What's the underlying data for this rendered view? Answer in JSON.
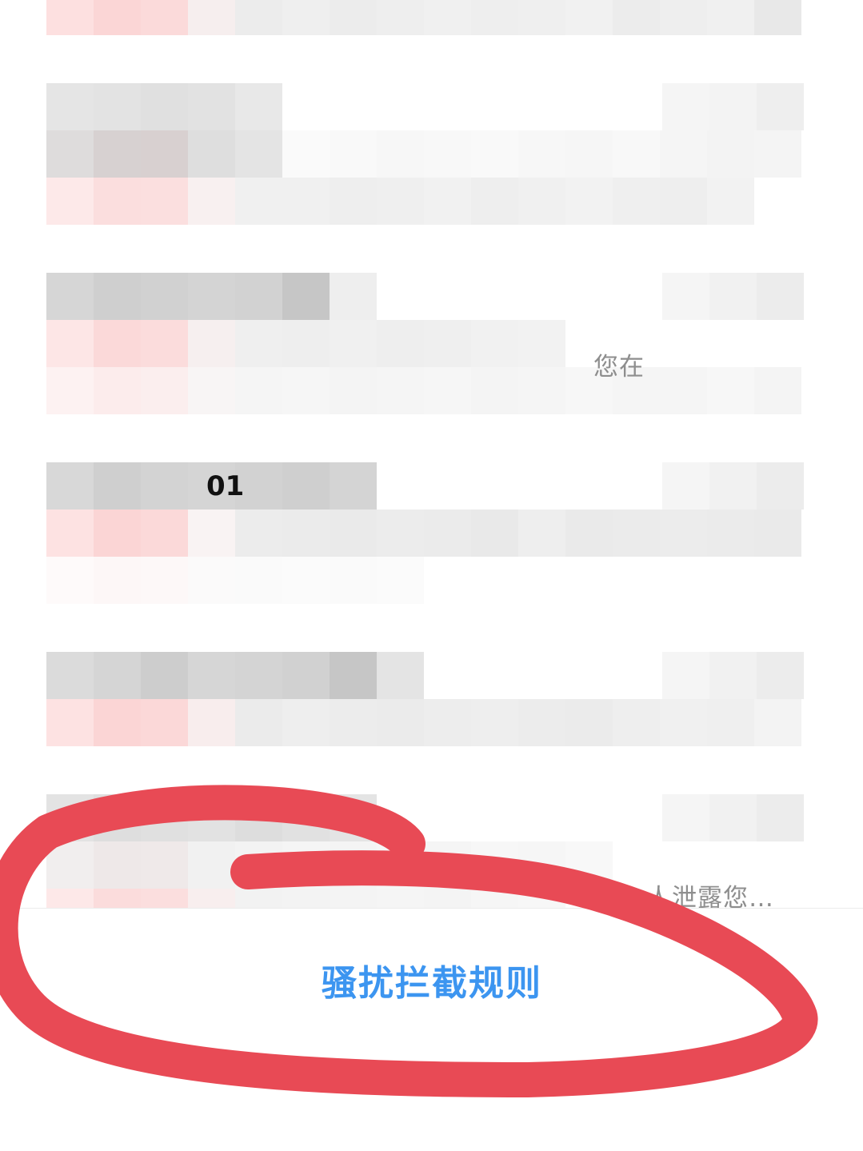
{
  "messages": [
    {
      "snippet": ""
    },
    {
      "snippet": ""
    },
    {
      "snippet": "您在"
    },
    {
      "snippet": ""
    },
    {
      "snippet": ""
    },
    {
      "snippet": "人泄露您…"
    }
  ],
  "fragment_text": "01",
  "footer": {
    "rule_link_label": "骚扰拦截规则"
  },
  "colors": {
    "link": "#3c95f0",
    "annotation": "#e84a55",
    "snippet": "#8e8e8e"
  }
}
